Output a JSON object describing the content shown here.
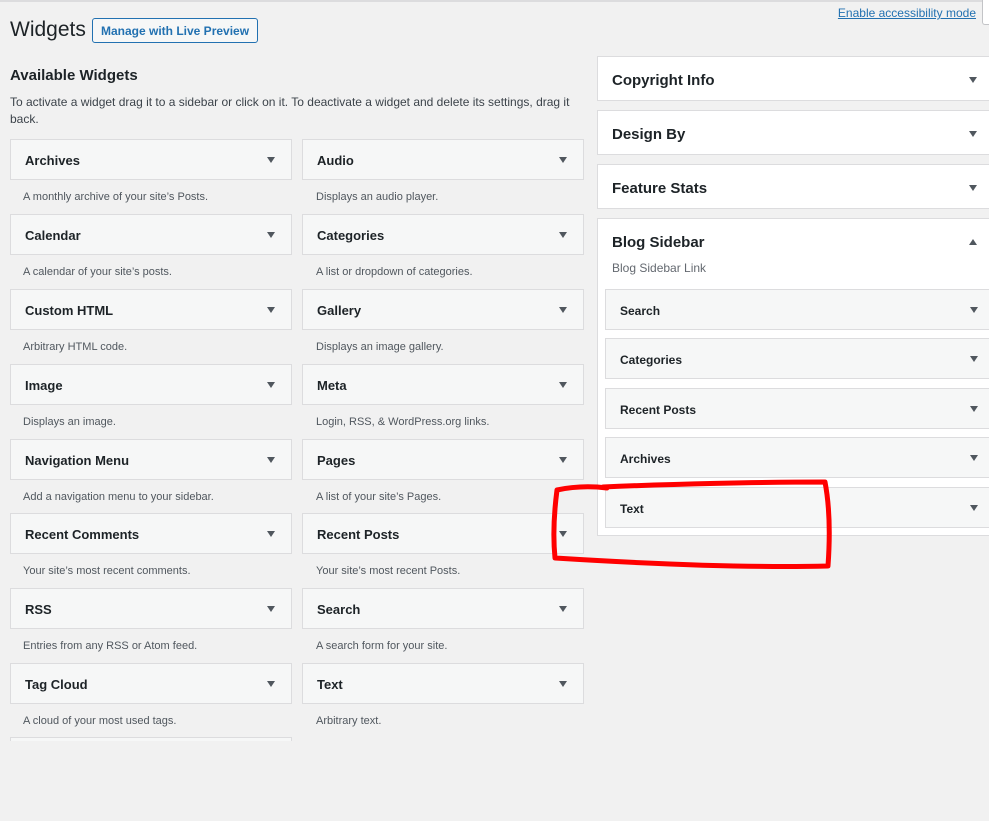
{
  "header": {
    "title": "Widgets",
    "live_preview_label": "Manage with Live Preview",
    "accessibility_link": "Enable accessibility mode"
  },
  "available": {
    "title": "Available Widgets",
    "description": "To activate a widget drag it to a sidebar or click on it. To deactivate a widget and delete its settings, drag it back.",
    "widgets": [
      {
        "name": "Archives",
        "desc": "A monthly archive of your site’s Posts."
      },
      {
        "name": "Audio",
        "desc": "Displays an audio player."
      },
      {
        "name": "Calendar",
        "desc": "A calendar of your site’s posts."
      },
      {
        "name": "Categories",
        "desc": "A list or dropdown of categories."
      },
      {
        "name": "Custom HTML",
        "desc": "Arbitrary HTML code."
      },
      {
        "name": "Gallery",
        "desc": "Displays an image gallery."
      },
      {
        "name": "Image",
        "desc": "Displays an image."
      },
      {
        "name": "Meta",
        "desc": "Login, RSS, & WordPress.org links."
      },
      {
        "name": "Navigation Menu",
        "desc": "Add a navigation menu to your sidebar."
      },
      {
        "name": "Pages",
        "desc": "A list of your site’s Pages."
      },
      {
        "name": "Recent Comments",
        "desc": "Your site’s most recent comments."
      },
      {
        "name": "Recent Posts",
        "desc": "Your site’s most recent Posts."
      },
      {
        "name": "RSS",
        "desc": "Entries from any RSS or Atom feed."
      },
      {
        "name": "Search",
        "desc": "A search form for your site."
      },
      {
        "name": "Tag Cloud",
        "desc": "A cloud of your most used tags."
      },
      {
        "name": "Text",
        "desc": "Arbitrary text."
      }
    ]
  },
  "areas": [
    {
      "title": "Copyright Info",
      "expanded": false
    },
    {
      "title": "Design By",
      "expanded": false
    },
    {
      "title": "Feature Stats",
      "expanded": false
    },
    {
      "title": "Blog Sidebar",
      "expanded": true,
      "description": "Blog Sidebar Link",
      "widgets": [
        "Search",
        "Categories",
        "Recent Posts",
        "Archives",
        "Text"
      ]
    }
  ],
  "icons": {
    "toggle_collapsed": "arrow-down-icon",
    "toggle_expanded": "arrow-up-icon"
  },
  "colors": {
    "link": "#2271b1",
    "highlight_annotation": "#ff0000"
  }
}
